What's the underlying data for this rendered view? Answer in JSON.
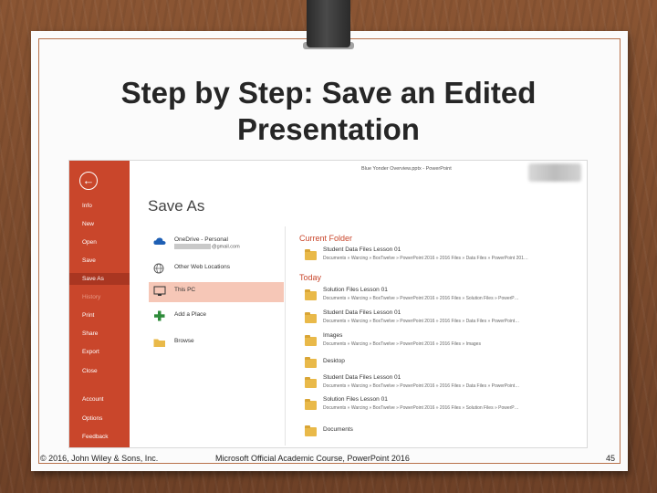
{
  "slide": {
    "title_line1": "Step by Step: Save an Edited",
    "title_line2": "Presentation",
    "footer_left": "© 2016, John Wiley & Sons, Inc.",
    "footer_center": "Microsoft Official Academic Course, PowerPoint 2016",
    "page_number": "45"
  },
  "screenshot": {
    "window_title": "Blue Yonder Overview.pptx - PowerPoint",
    "sidebar": {
      "back_icon": "back-arrow-icon",
      "items": [
        "Info",
        "New",
        "Open",
        "Save",
        "Save As",
        "History",
        "Print",
        "Share",
        "Export",
        "Close",
        "Account",
        "Options",
        "Feedback"
      ],
      "active": "Save As"
    },
    "heading": "Save As",
    "locations": [
      {
        "label": "OneDrive - Personal",
        "sub": "@gmail.com",
        "icon": "cloud-icon"
      },
      {
        "label": "Other Web Locations",
        "icon": "globe-icon"
      },
      {
        "label": "This PC",
        "icon": "computer-icon"
      },
      {
        "label": "Add a Place",
        "icon": "plus-icon"
      },
      {
        "label": "Browse",
        "icon": "folder-icon"
      }
    ],
    "current_folder_heading": "Current Folder",
    "current_folder": {
      "name": "Student Data Files Lesson 01",
      "path": "Documents » Warcing » BoxTwelve » PowerPoint 2016 » 2016 Files » Data Files » PowerPoint 201…"
    },
    "today_heading": "Today",
    "today_folders": [
      {
        "name": "Solution Files Lesson 01",
        "path": "Documents » Warcing » BoxTwelve » PowerPoint 2016 » 2016 Files » Solution Files » PowerP…"
      },
      {
        "name": "Student Data Files Lesson 01",
        "path": "Documents » Warcing » BoxTwelve » PowerPoint 2016 » 2016 Files » Data Files » PowerPoint…"
      },
      {
        "name": "Images",
        "path": "Documents » Warcing » BoxTwelve » PowerPoint 2016 » 2016 Files » Images"
      },
      {
        "name": "Desktop",
        "path": ""
      },
      {
        "name": "Student Data Files Lesson 01",
        "path": "Documents » Warcing » BoxTwelve » PowerPoint 2016 » 2016 Files » Data Files » PowerPoint…"
      },
      {
        "name": "Solution Files Lesson 01",
        "path": "Documents » Warcing » BoxTwelve » PowerPoint 2016 » 2016 Files » Solution Files » PowerP…"
      },
      {
        "name": "Documents",
        "path": ""
      }
    ],
    "colors": {
      "accent": "#c9462b",
      "active_location": "#f6c7b7",
      "folder": "#e9b949"
    }
  }
}
